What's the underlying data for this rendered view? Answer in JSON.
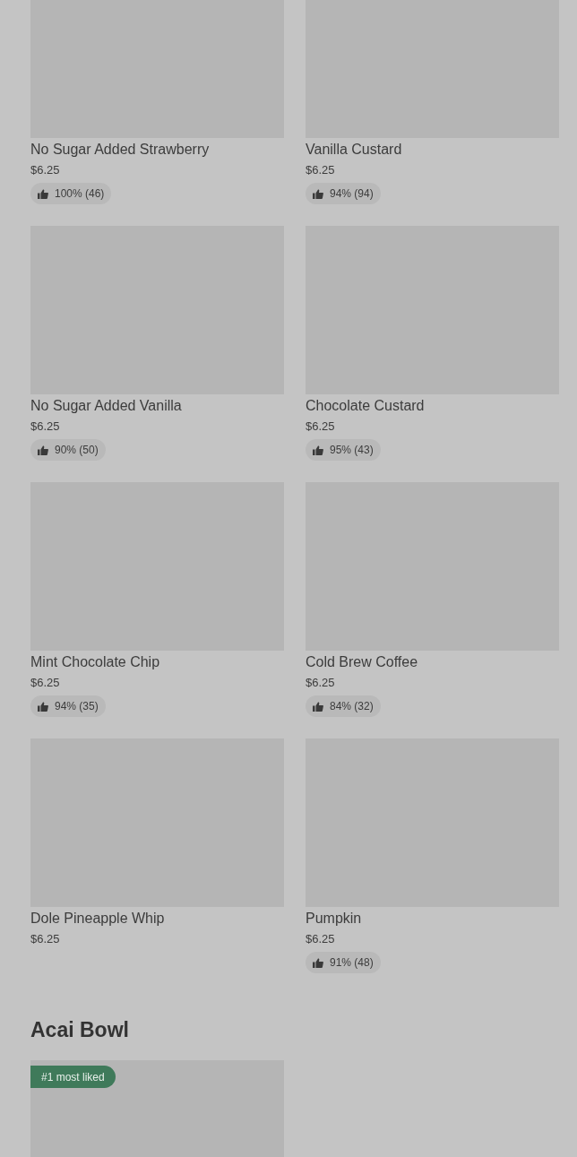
{
  "items": [
    {
      "name": "No Sugar Added Strawberry",
      "price": "$6.25",
      "rating": "100% (46)"
    },
    {
      "name": "Vanilla Custard",
      "price": "$6.25",
      "rating": "94% (94)"
    },
    {
      "name": "No Sugar Added Vanilla",
      "price": "$6.25",
      "rating": "90% (50)"
    },
    {
      "name": "Chocolate Custard",
      "price": "$6.25",
      "rating": "95% (43)"
    },
    {
      "name": "Mint Chocolate Chip",
      "price": "$6.25",
      "rating": "94% (35)"
    },
    {
      "name": "Cold Brew Coffee",
      "price": "$6.25",
      "rating": "84% (32)"
    },
    {
      "name": "Dole Pineapple Whip",
      "price": "$6.25"
    },
    {
      "name": "Pumpkin",
      "price": "$6.25",
      "rating": "91% (48)"
    }
  ],
  "next_section": {
    "title": "Acai Bowl",
    "items": [
      {
        "badge": "#1 most liked"
      }
    ]
  }
}
